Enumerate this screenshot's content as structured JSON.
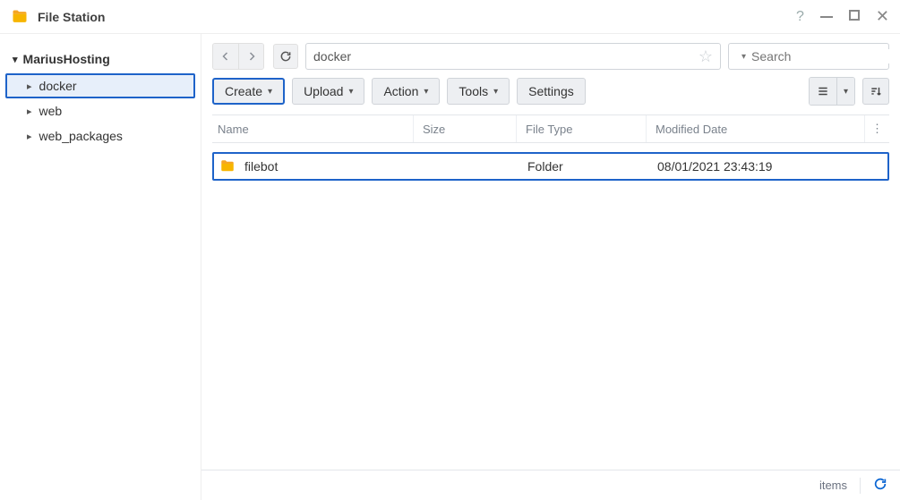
{
  "app": {
    "title": "File Station"
  },
  "sidebar": {
    "rootLabel": "MariusHosting",
    "items": [
      {
        "label": "docker",
        "selected": true
      },
      {
        "label": "web",
        "selected": false
      },
      {
        "label": "web_packages",
        "selected": false
      }
    ]
  },
  "toolbar": {
    "path": "docker",
    "searchPlaceholder": "Search",
    "buttons": {
      "create": "Create",
      "upload": "Upload",
      "action": "Action",
      "tools": "Tools",
      "settings": "Settings"
    }
  },
  "table": {
    "columns": {
      "name": "Name",
      "size": "Size",
      "type": "File Type",
      "modified": "Modified Date"
    },
    "rows": [
      {
        "name": "filebot",
        "size": "",
        "type": "Folder",
        "modified": "08/01/2021 23:43:19"
      }
    ]
  },
  "status": {
    "itemsLabel": "items"
  }
}
